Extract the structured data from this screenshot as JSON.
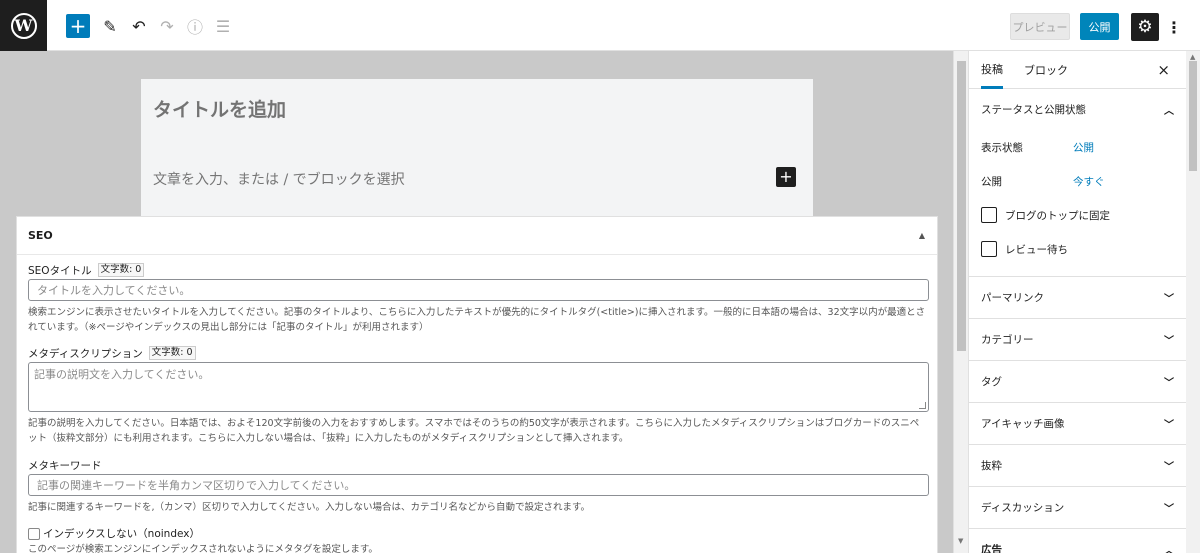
{
  "toolbar": {
    "logo": "W",
    "add_icon": "+",
    "edit_icon": "✎",
    "undo_icon": "↶",
    "redo_icon": "↷",
    "info_icon": "ⓘ",
    "list_icon": "☰",
    "preview_label": "プレビュー",
    "publish_label": "公開",
    "settings_icon": "⚙",
    "more_icon": "⋮"
  },
  "editor": {
    "title_placeholder": "タイトルを追加",
    "body_placeholder": "文章を入力、または / でブロックを選択",
    "add_block_icon": "+"
  },
  "seo": {
    "heading": "SEO",
    "collapse_icon": "▲",
    "title_label": "SEOタイトル",
    "title_count": "文字数: 0",
    "title_placeholder": "タイトルを入力してください。",
    "title_help": "検索エンジンに表示させたいタイトルを入力してください。記事のタイトルより、こちらに入力したテキストが優先的にタイトルタグ(<title>)に挿入されます。一般的に日本語の場合は、32文字以内が最適とされています。（※ページやインデックスの見出し部分には「記事のタイトル」が利用されます）",
    "desc_label": "メタディスクリプション",
    "desc_count": "文字数: 0",
    "desc_placeholder": "記事の説明文を入力してください。",
    "desc_help": "記事の説明を入力してください。日本語では、およそ120文字前後の入力をおすすめします。スマホではそのうちの約50文字が表示されます。こちらに入力したメタディスクリプションはブログカードのスニペット（抜粋文部分）にも利用されます。こちらに入力しない場合は、「抜粋」に入力したものがメタディスクリプションとして挿入されます。",
    "kw_label": "メタキーワード",
    "kw_placeholder": "記事の関連キーワードを半角カンマ区切りで入力してください。",
    "kw_help": "記事に関連するキーワードを,（カンマ）区切りで入力してください。入力しない場合は、カテゴリ名などから自動で設定されます。",
    "noindex_label": "インデックスしない（noindex）",
    "noindex_help": "このページが検索エンジンにインデックスされないようにメタタグを設定します。"
  },
  "sidebar": {
    "tabs": [
      "投稿",
      "ブロック"
    ],
    "close_icon": "×",
    "status_heading": "ステータスと公開状態",
    "visibility_label": "表示状態",
    "visibility_value": "公開",
    "publish_label": "公開",
    "publish_value": "今すぐ",
    "sticky_label": "ブログのトップに固定",
    "pending_label": "レビュー待ち",
    "sections": [
      "パーマリンク",
      "カテゴリー",
      "タグ",
      "アイキャッチ画像",
      "抜粋",
      "ディスカッション",
      "広告"
    ],
    "chevron_up": "︿",
    "chevron_down": "﹀"
  },
  "colors": {
    "accent": "#007cba",
    "dark": "#1e1e1e",
    "canvas": "#c9c9c9"
  }
}
